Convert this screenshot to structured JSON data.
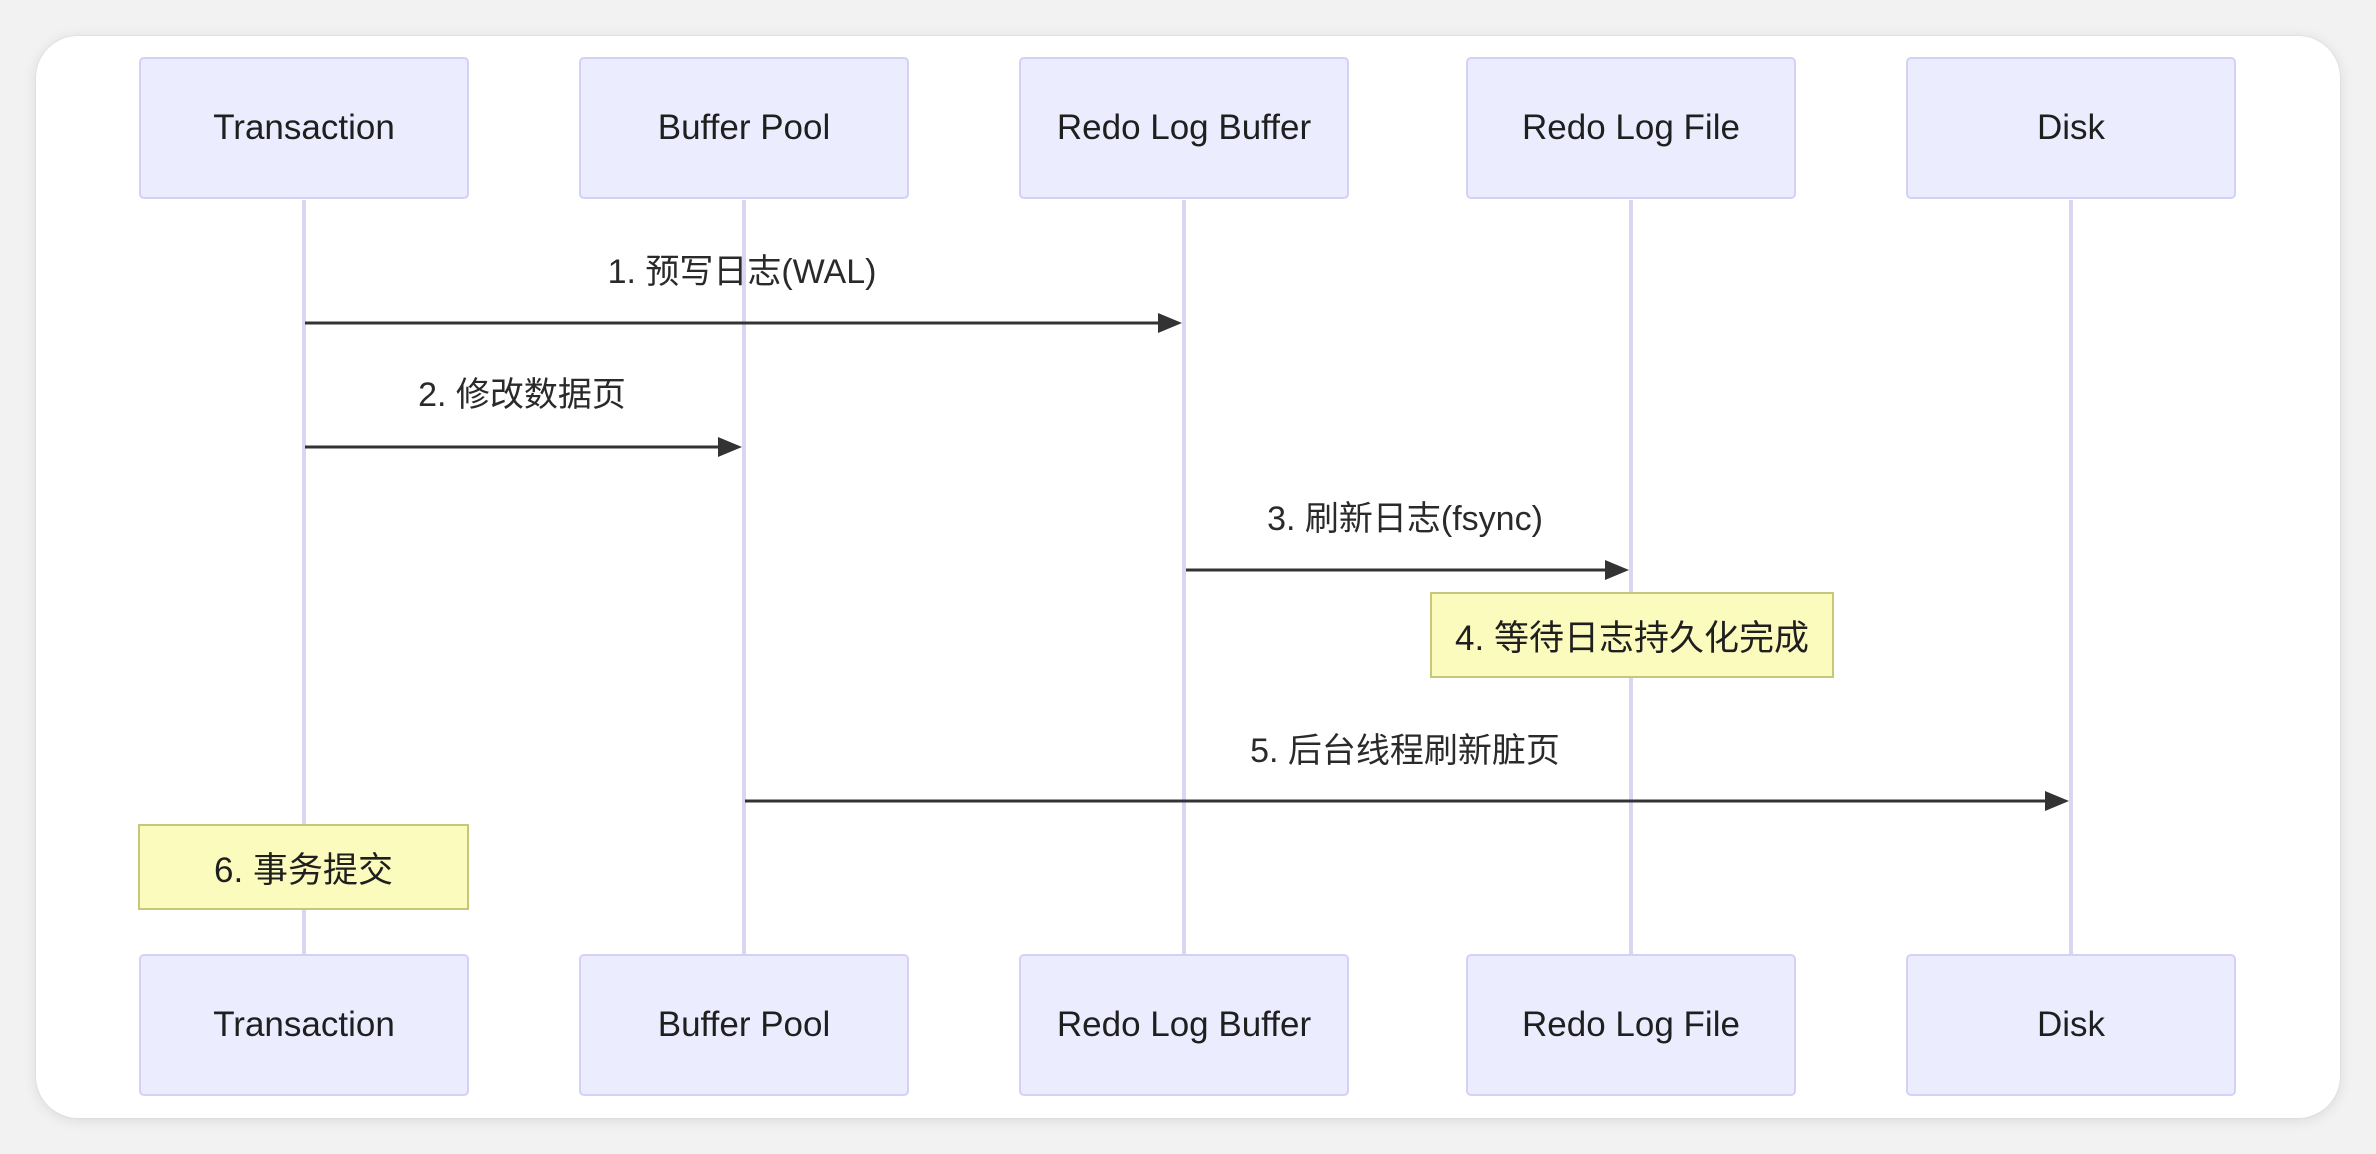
{
  "diagram": {
    "type": "sequence",
    "participants": [
      {
        "id": "transaction",
        "label": "Transaction"
      },
      {
        "id": "buffer_pool",
        "label": "Buffer Pool"
      },
      {
        "id": "redo_log_buffer",
        "label": "Redo Log Buffer"
      },
      {
        "id": "redo_log_file",
        "label": "Redo Log File"
      },
      {
        "id": "disk",
        "label": "Disk"
      }
    ],
    "messages": [
      {
        "from": "transaction",
        "to": "redo_log_buffer",
        "label": "1. 预写日志(WAL)"
      },
      {
        "from": "transaction",
        "to": "buffer_pool",
        "label": "2. 修改数据页"
      },
      {
        "from": "redo_log_buffer",
        "to": "redo_log_file",
        "label": "3. 刷新日志(fsync)"
      },
      {
        "from": "buffer_pool",
        "to": "disk",
        "label": "5. 后台线程刷新脏页"
      }
    ],
    "notes": [
      {
        "over": "redo_log_file",
        "label": "4. 等待日志持久化完成"
      },
      {
        "over": "transaction",
        "label": "6. 事务提交"
      }
    ],
    "colors": {
      "actor_fill": "#ececff",
      "actor_border": "#d5d0f5",
      "lifeline": "#dad6f2",
      "arrow": "#333333",
      "note_fill": "#fbfbbd",
      "note_border": "#c5c77a"
    }
  }
}
